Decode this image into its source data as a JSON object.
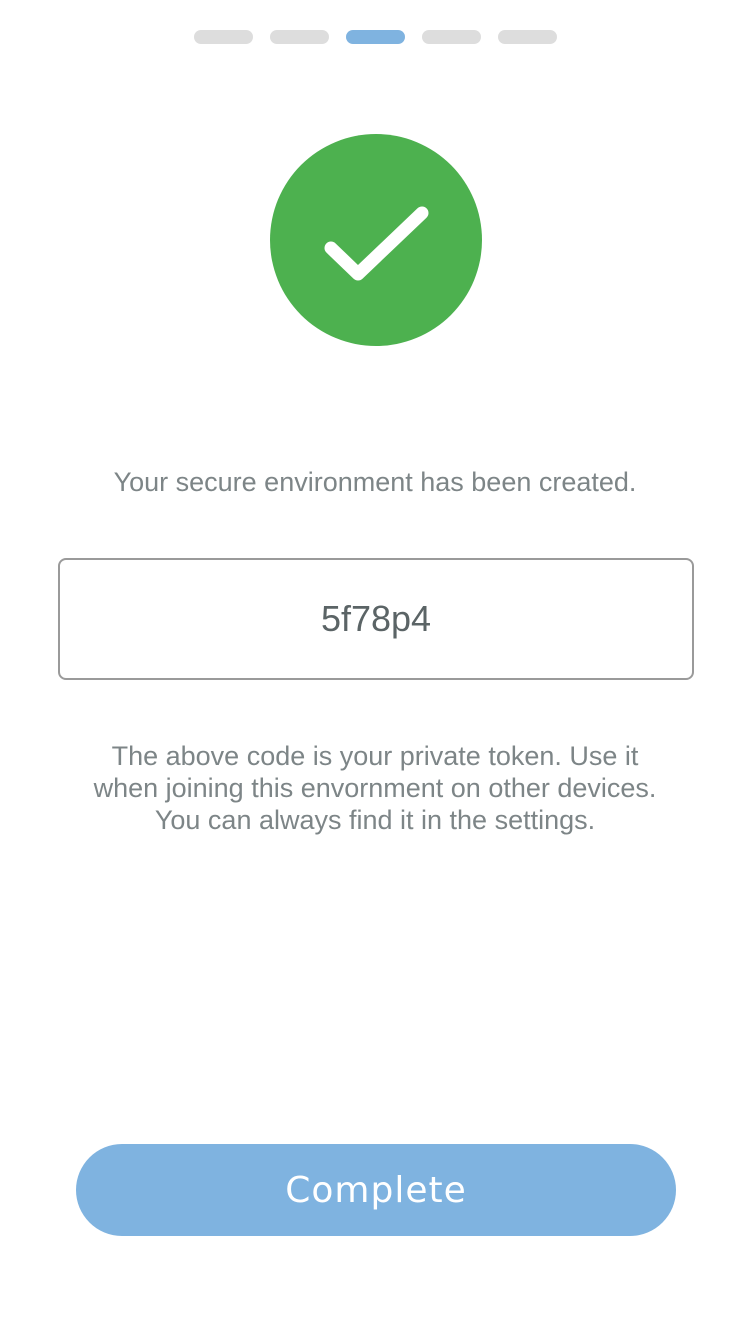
{
  "progress": {
    "total_steps": 5,
    "current_step": 3,
    "active_color": "#7fb3e0",
    "inactive_color": "#dddddd"
  },
  "status": {
    "icon": "checkmark-icon",
    "color": "#4db14f"
  },
  "message": "Your secure environment has been created.",
  "token": {
    "value": "5f78p4"
  },
  "info": {
    "line1": "The above code is your private token. Use it",
    "line2": "when joining this envornment on other devices.",
    "line3": "You can always find it in the settings."
  },
  "actions": {
    "complete_label": "Complete",
    "complete_color": "#7fb3e0"
  }
}
